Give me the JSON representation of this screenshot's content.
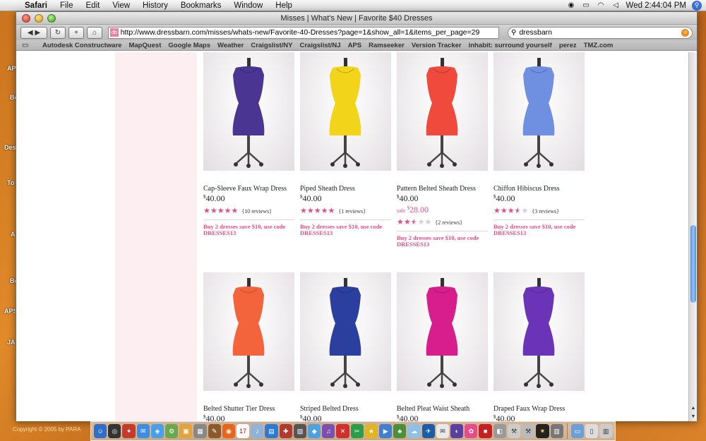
{
  "menubar": {
    "app": "Safari",
    "items": [
      "File",
      "Edit",
      "View",
      "History",
      "Bookmarks",
      "Window",
      "Help"
    ],
    "clock": "Wed 2:44:04 PM"
  },
  "desktop_labels": [
    "APS",
    "Bo",
    "Des",
    "To",
    "A",
    "Bo",
    "APS",
    "JA"
  ],
  "window": {
    "title": "Misses | What's New | Favorite $40 Dresses",
    "url": "http://www.dressbarn.com/misses/whats-new/Favorite-40-Dresses?page=1&show_all=1&items_per_page=29",
    "search_value": "dressbarn"
  },
  "bookmarks": [
    "Autodesk Constructware",
    "MapQuest",
    "Google Maps",
    "Weather",
    "Craigslist/NY",
    "Craigslist/NJ",
    "APS",
    "Ramseeker",
    "Version Tracker",
    "inhabit: surround yourself",
    "perez",
    "TMZ.com"
  ],
  "products": [
    {
      "name": "Cap-Sleeve Faux Wrap Dress",
      "price": "40.00",
      "currency": "$",
      "rating": 5,
      "reviews": "{10 reviews}",
      "promo": "Buy 2 dresses save $10, use code DRESSES13",
      "dress_color": "#4b3593"
    },
    {
      "name": "Piped Sheath Dress",
      "price": "40.00",
      "currency": "$",
      "rating": 5,
      "reviews": "{1 reviews}",
      "promo": "Buy 2 dresses save $10, use code DRESSES13",
      "dress_color": "#f2d51a"
    },
    {
      "name": "Pattern Belted Sheath Dress",
      "price": "40.00",
      "currency": "$",
      "sale_label": "sale",
      "sale_price": "28.00",
      "rating": 2.5,
      "reviews": "{2 reviews}",
      "promo": "Buy 2 dresses save $10, use code DRESSES13",
      "dress_color": "#ef4a3c"
    },
    {
      "name": "Chiffon Hibiscus Dress",
      "price": "40.00",
      "currency": "$",
      "rating": 3.5,
      "reviews": "{3 reviews}",
      "promo": "Buy 2 dresses save $10, use code DRESSES13",
      "dress_color": "#6f8fe0"
    },
    {
      "name": "Belted Shutter Tier Dress",
      "price": "40.00",
      "currency": "$",
      "dress_color": "#f4643c"
    },
    {
      "name": "Striped Belted Dress",
      "price": "40.00",
      "currency": "$",
      "dress_color": "#2a3f9e"
    },
    {
      "name": "Belted Pleat Waist Sheath",
      "price": "40.00",
      "currency": "$",
      "dress_color": "#d81e8c"
    },
    {
      "name": "Draped Faux Wrap Dress",
      "price": "40.00",
      "currency": "$",
      "dress_color": "#6b34b8"
    }
  ],
  "footer": "Copyright © 2005 by PARA"
}
